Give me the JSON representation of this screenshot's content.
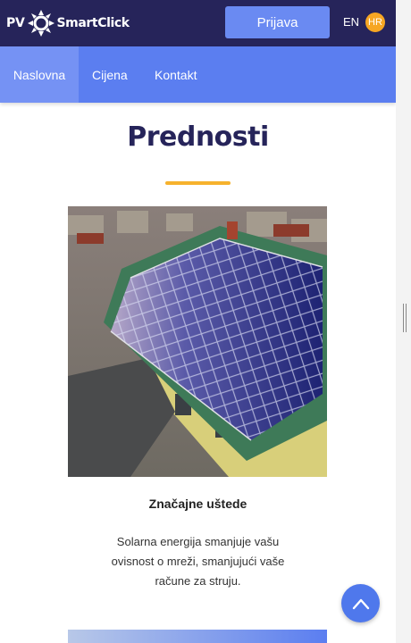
{
  "brand": {
    "prefix": "PV",
    "name": "SmartClick"
  },
  "header": {
    "login_label": "Prijava",
    "lang_en": "EN",
    "lang_hr": "HR"
  },
  "nav": {
    "home": "Naslovna",
    "price": "Cijena",
    "contact": "Kontakt"
  },
  "section": {
    "title": "Prednosti",
    "card": {
      "title": "Značajne uštede",
      "text": "Solarna energija smanjuje vašu ovisnost o mreži, smanjujući vaše račune za struju."
    }
  },
  "colors": {
    "header_bg": "#26245a",
    "nav_bg": "#5b7ef0",
    "accent": "#f6b22d",
    "button": "#6a8af2"
  },
  "icons": {
    "scroll_top": "chevron-up-icon",
    "logo": "sun-icon"
  }
}
